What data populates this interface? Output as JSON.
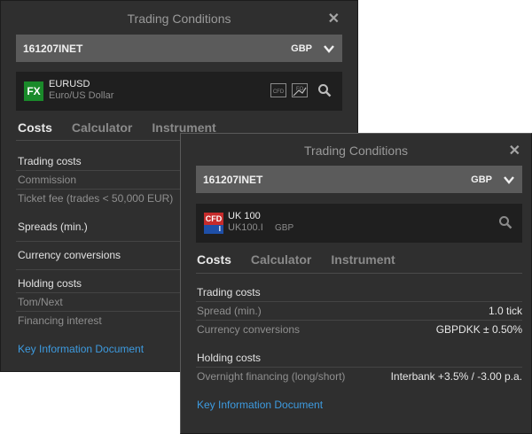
{
  "back": {
    "title": "Trading Conditions",
    "account_id": "161207INET",
    "account_currency": "GBP",
    "instrument": {
      "badge_text": "FX",
      "symbol": "EURUSD",
      "description": "Euro/US Dollar",
      "badge_color": "#1a8a2a"
    },
    "tabs": [
      "Costs",
      "Calculator",
      "Instrument"
    ],
    "rows": {
      "trading_costs": "Trading costs",
      "commission": "Commission",
      "ticket_fee": "Ticket fee (trades < 50,000 EUR)",
      "spreads": "Spreads (min.)",
      "currency_conversions": "Currency conversions",
      "holding_costs": "Holding costs",
      "tom_next": "Tom/Next",
      "financing_interest": "Financing interest"
    },
    "kid_link": "Key Information Document"
  },
  "front": {
    "title": "Trading Conditions",
    "account_id": "161207INET",
    "account_currency": "GBP",
    "instrument": {
      "badge_top": "CFD",
      "badge_bottom": "I",
      "symbol": "UK 100",
      "description": "UK100.I",
      "currency": "GBP",
      "badge_color": "#c62b2b",
      "badge_color2": "#1e4fa8"
    },
    "tabs": [
      "Costs",
      "Calculator",
      "Instrument"
    ],
    "rows": {
      "trading_costs": "Trading costs",
      "spread_label": "Spread (min.)",
      "spread_value": "1.0 tick",
      "conv_label": "Currency conversions",
      "conv_value": "GBPDKK ± 0.50%",
      "holding_costs": "Holding costs",
      "overnight_label": "Overnight financing (long/short)",
      "overnight_value": "Interbank +3.5% / -3.00 p.a."
    },
    "kid_link": "Key Information Document"
  },
  "colors": {
    "link": "#3d9be0",
    "panel_bg": "#2f2f2f",
    "account_bar": "#5b5b5b"
  }
}
